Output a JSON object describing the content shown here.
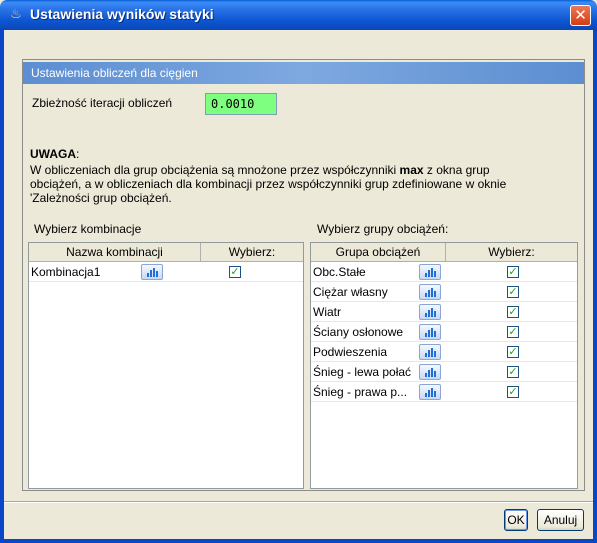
{
  "window": {
    "title": "Ustawienia wyników statyki",
    "close_glyph": "✕"
  },
  "section": {
    "header": "Ustawienia obliczeń dla cięgien",
    "convergence_label": "Zbieżność iteracji obliczeń",
    "convergence_value": "0.0010"
  },
  "warning": {
    "title": "UWAGA",
    "title_suffix": ":",
    "line1_pre": "W obliczeniach dla grup obciążenia są mnożone przez współczynniki ",
    "line1_bold": "max",
    "line1_post": " z okna grup",
    "line2": "obciążeń, a w obliczeniach dla kombinacji przez współczynniki grup zdefiniowane w oknie",
    "line3": "'Zależności grup obciążeń."
  },
  "combinations": {
    "label": "Wybierz kombinacje",
    "columns": [
      "Nazwa kombinacji",
      "Wybierz:"
    ],
    "rows": [
      {
        "name": "Kombinacja1",
        "checked": true
      }
    ]
  },
  "load_groups": {
    "label": "Wybierz grupy obciążeń:",
    "columns": [
      "Grupa obciążeń",
      "Wybierz:"
    ],
    "rows": [
      {
        "name": "Obc.Stałe",
        "checked": true
      },
      {
        "name": "Ciężar własny",
        "checked": true
      },
      {
        "name": " Wiatr",
        "checked": true
      },
      {
        "name": "Ściany osłonowe",
        "checked": true
      },
      {
        "name": "Podwieszenia",
        "checked": true
      },
      {
        "name": "Śnieg - lewa połać",
        "checked": true
      },
      {
        "name": "Śnieg - prawa p...",
        "checked": true
      }
    ]
  },
  "buttons": {
    "ok": "OK",
    "cancel": "Anuluj"
  },
  "colors": {
    "title_bar": "#0a5fd8",
    "section_header": "#6b98d8",
    "input_bg": "#7fff7f",
    "check": "#21a121"
  }
}
